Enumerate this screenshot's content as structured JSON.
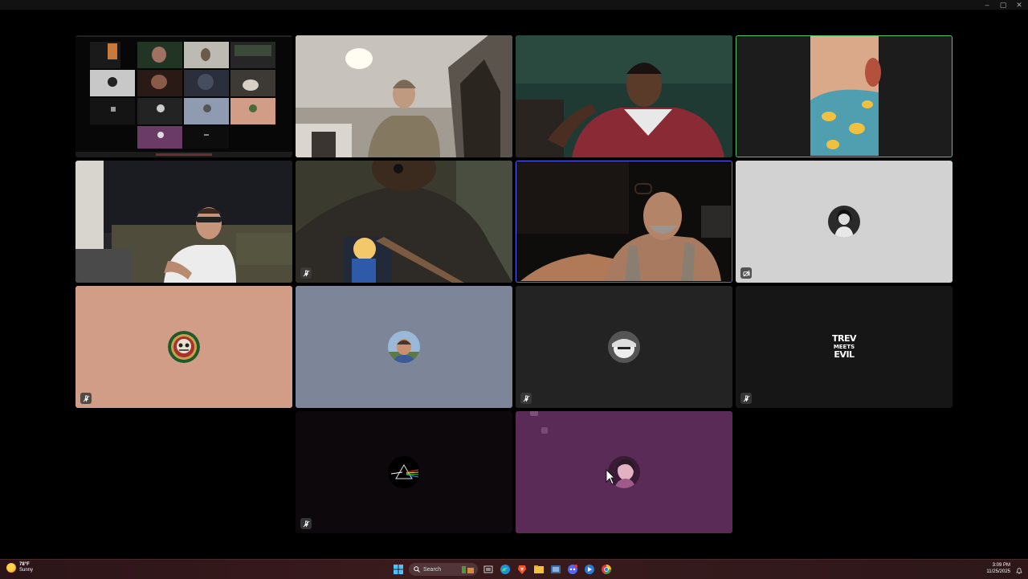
{
  "window": {
    "controls": {
      "minimize": "–",
      "maximize": "▢",
      "close": "✕"
    }
  },
  "tiles": [
    {
      "id": "screen-share",
      "kind": "screen-share",
      "muted": false
    },
    {
      "id": "participant-hoodie",
      "kind": "video",
      "muted": false
    },
    {
      "id": "participant-red-jacket",
      "kind": "video",
      "muted": false
    },
    {
      "id": "participant-speaking",
      "kind": "video",
      "muted": false,
      "speaking": true
    },
    {
      "id": "participant-glasses-couch",
      "kind": "video",
      "muted": false
    },
    {
      "id": "participant-beard",
      "kind": "video",
      "muted": true
    },
    {
      "id": "participant-car",
      "kind": "video",
      "muted": false,
      "pinned": true
    },
    {
      "id": "participant-bw-photo",
      "kind": "avatar",
      "muted": false,
      "background": "#d2d2d2"
    },
    {
      "id": "participant-grateful",
      "kind": "avatar",
      "muted": true,
      "background": "#d19d86"
    },
    {
      "id": "participant-blue",
      "kind": "avatar",
      "muted": false,
      "background": "#7d8699"
    },
    {
      "id": "participant-grey",
      "kind": "avatar",
      "muted": true,
      "background": "#232323"
    },
    {
      "id": "participant-trev",
      "kind": "avatar",
      "muted": true,
      "background": "#161616",
      "logo_text": [
        "TREV",
        "MEETS",
        "EVIL"
      ]
    },
    {
      "id": "participant-prism",
      "kind": "avatar",
      "muted": true,
      "background": "#0c080b"
    },
    {
      "id": "participant-purple",
      "kind": "avatar",
      "muted": false,
      "background": "#5a2b56"
    }
  ],
  "taskbar": {
    "weather_temp": "78°F",
    "weather_condition": "Sunny",
    "search_label": "Search",
    "clock_time": "3:09 PM",
    "clock_date": "11/25/2025",
    "apps": [
      "start-icon",
      "search-icon",
      "widgets-icon",
      "task-view-icon",
      "edge-icon",
      "brave-icon",
      "file-explorer-icon",
      "files-icon",
      "discord-icon",
      "app-icon",
      "chrome-icon"
    ]
  },
  "colors": {
    "speaking_border": "#55c36a",
    "pinned_border": "#5a63ff",
    "background": "#000000"
  }
}
